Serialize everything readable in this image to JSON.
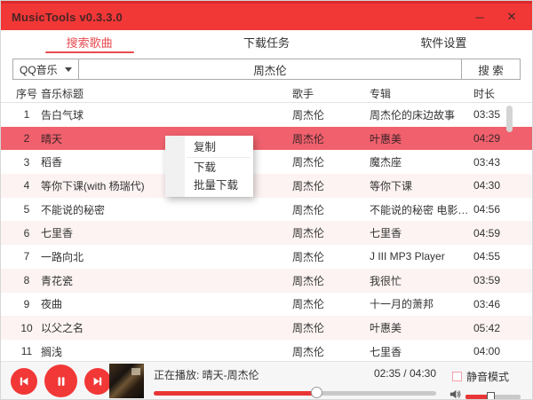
{
  "window": {
    "title": "MusicTools v0.3.3.0",
    "minimize_glyph": "─",
    "close_glyph": "✕"
  },
  "tabs": [
    {
      "label": "搜索歌曲",
      "active": true
    },
    {
      "label": "下载任务",
      "active": false
    },
    {
      "label": "软件设置",
      "active": false
    }
  ],
  "search": {
    "source": "QQ音乐",
    "query": "周杰伦",
    "button_label": "搜 索"
  },
  "table": {
    "headers": [
      "序号",
      "音乐标题",
      "歌手",
      "专辑",
      "时长"
    ],
    "rows": [
      {
        "index": "1",
        "title": "告白气球",
        "artist": "周杰伦",
        "album": "周杰伦的床边故事",
        "duration": "03:35",
        "selected": false
      },
      {
        "index": "2",
        "title": "晴天",
        "artist": "周杰伦",
        "album": "叶惠美",
        "duration": "04:29",
        "selected": true
      },
      {
        "index": "3",
        "title": "稻香",
        "artist": "周杰伦",
        "album": "魔杰座",
        "duration": "03:43",
        "selected": false
      },
      {
        "index": "4",
        "title": "等你下课(with 杨瑞代)",
        "artist": "周杰伦",
        "album": "等你下课",
        "duration": "04:30",
        "selected": false
      },
      {
        "index": "5",
        "title": "不能说的秘密",
        "artist": "周杰伦",
        "album": "不能说的秘密 电影原声…",
        "duration": "04:56",
        "selected": false
      },
      {
        "index": "6",
        "title": "七里香",
        "artist": "周杰伦",
        "album": "七里香",
        "duration": "04:59",
        "selected": false
      },
      {
        "index": "7",
        "title": "一路向北",
        "artist": "周杰伦",
        "album": "J III MP3 Player",
        "duration": "04:55",
        "selected": false
      },
      {
        "index": "8",
        "title": "青花瓷",
        "artist": "周杰伦",
        "album": "我很忙",
        "duration": "03:59",
        "selected": false
      },
      {
        "index": "9",
        "title": "夜曲",
        "artist": "周杰伦",
        "album": "十一月的萧邦",
        "duration": "03:46",
        "selected": false
      },
      {
        "index": "10",
        "title": "以父之名",
        "artist": "周杰伦",
        "album": "叶惠美",
        "duration": "05:42",
        "selected": false
      },
      {
        "index": "11",
        "title": "搁浅",
        "artist": "周杰伦",
        "album": "七里香",
        "duration": "04:00",
        "selected": false
      }
    ]
  },
  "context_menu": {
    "items": [
      "复制",
      "下载",
      "批量下载"
    ]
  },
  "player": {
    "now_playing": "正在播放: 晴天-周杰伦",
    "time": "02:35 / 04:30",
    "progress_percent": 58,
    "volume_percent": 45,
    "mute_label": "静音模式",
    "muted": false
  },
  "colors": {
    "accent_red": "#f23737",
    "accent_dark_red": "#d92b2b",
    "accent_text_red": "#e84c52",
    "selected_row": "#f0616d",
    "row_tint": "#fdf3f3",
    "bar_red": "#e93535"
  }
}
